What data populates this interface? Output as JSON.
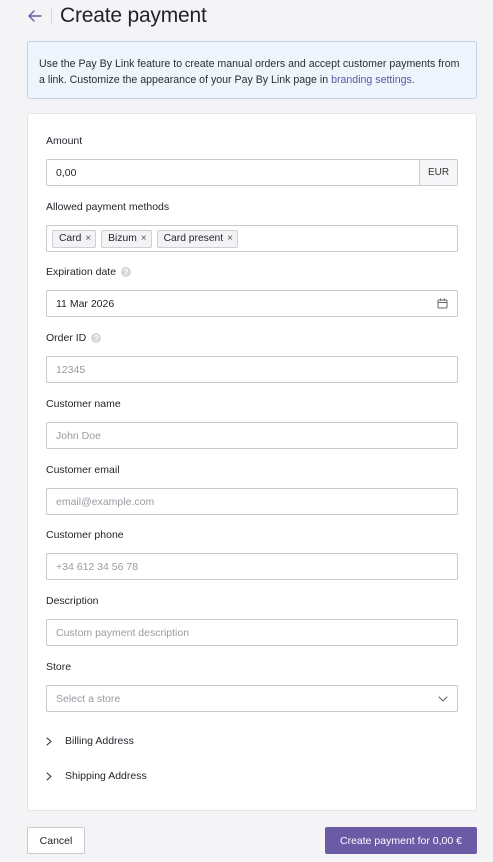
{
  "header": {
    "title": "Create payment"
  },
  "info": {
    "text_before_link": "Use the Pay By Link feature to create manual orders and accept customer payments from a link. Customize the appearance of your Pay By Link page in ",
    "link_text": "branding settings",
    "text_after_link": "."
  },
  "form": {
    "amount": {
      "label": "Amount",
      "value": "0,00",
      "currency": "EUR"
    },
    "payment_methods": {
      "label": "Allowed payment methods",
      "tags": [
        "Card",
        "Bizum",
        "Card present"
      ]
    },
    "expiration": {
      "label": "Expiration date",
      "value": "11 Mar 2026"
    },
    "order_id": {
      "label": "Order ID",
      "placeholder": "12345"
    },
    "customer_name": {
      "label": "Customer name",
      "placeholder": "John Doe"
    },
    "customer_email": {
      "label": "Customer email",
      "placeholder": "email@example.com"
    },
    "customer_phone": {
      "label": "Customer phone",
      "placeholder": "+34 612 34 56 78"
    },
    "description": {
      "label": "Description",
      "placeholder": "Custom payment description"
    },
    "store": {
      "label": "Store",
      "placeholder": "Select a store"
    },
    "billing_address": {
      "label": "Billing Address"
    },
    "shipping_address": {
      "label": "Shipping Address"
    }
  },
  "footer": {
    "cancel_label": "Cancel",
    "create_label": "Create payment for 0,00 €"
  },
  "colors": {
    "accent": "#6b5aa6",
    "info_bg": "#eef5fc",
    "info_border": "#bcd4ec"
  },
  "icons": {
    "back": "arrow-left-icon",
    "help": "help-circle-icon",
    "calendar": "calendar-icon",
    "dropdown": "chevron-down-icon",
    "expand": "chevron-right-icon",
    "remove_tag": "close-icon"
  }
}
